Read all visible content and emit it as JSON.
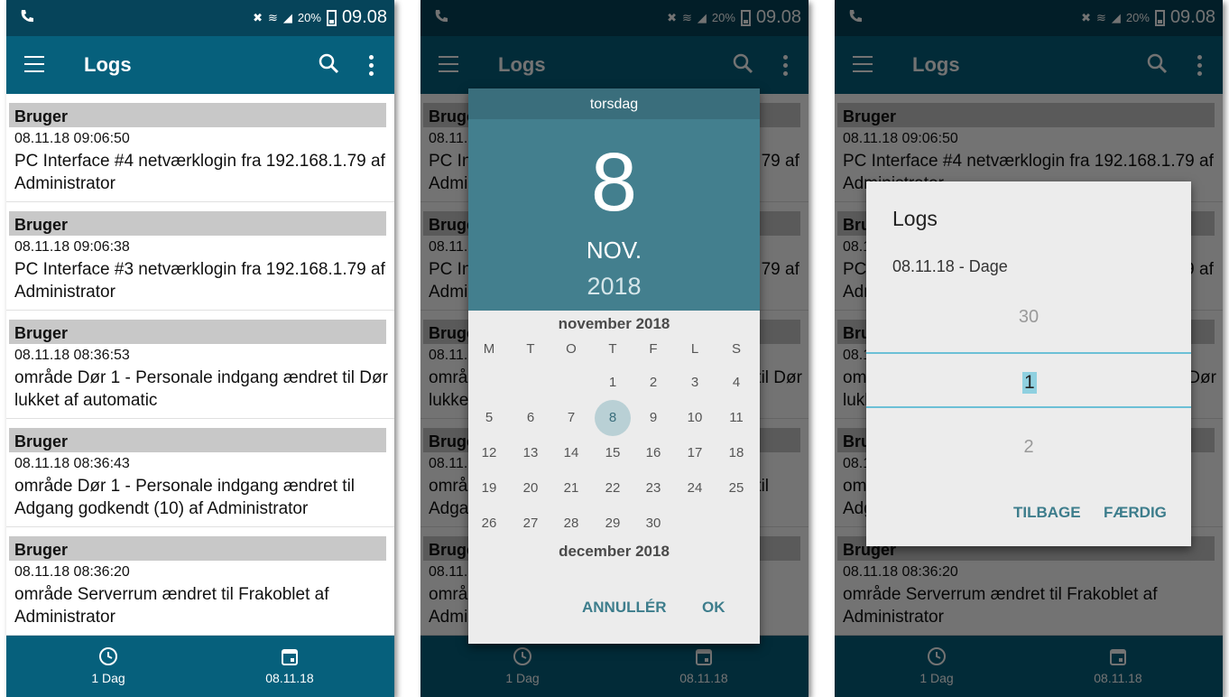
{
  "status": {
    "battery": "20%",
    "time": "09.08"
  },
  "appbar": {
    "title": "Logs"
  },
  "logs": [
    {
      "category": "Bruger",
      "timestamp": "08.11.18 09:06:50",
      "message": "PC Interface #4 netværklogin fra 192.168.1.79 af Administrator"
    },
    {
      "category": "Bruger",
      "timestamp": "08.11.18 09:06:38",
      "message": "PC Interface #3 netværklogin fra 192.168.1.79 af Administrator"
    },
    {
      "category": "Bruger",
      "timestamp": "08.11.18 08:36:53",
      "message": "område Dør 1 - Personale indgang ændret til Dør lukket af automatic"
    },
    {
      "category": "Bruger",
      "timestamp": "08.11.18 08:36:43",
      "message": "område Dør 1 - Personale indgang ændret til Adgang godkendt (10) af Administrator"
    },
    {
      "category": "Bruger",
      "timestamp": "08.11.18 08:36:20",
      "message": "område Serverrum ændret til Frakoblet af Administrator"
    }
  ],
  "bottombar": {
    "range_label": "1 Dag",
    "date_label": "08.11.18"
  },
  "datepicker": {
    "weekday": "torsdag",
    "day": "8",
    "month": "NOV.",
    "year": "2018",
    "month_title": "november 2018",
    "next_month_title": "december 2018",
    "weekday_headers": [
      "M",
      "T",
      "O",
      "T",
      "F",
      "L",
      "S"
    ],
    "days": [
      "1",
      "2",
      "3",
      "4",
      "5",
      "6",
      "7",
      "8",
      "9",
      "10",
      "11",
      "12",
      "13",
      "14",
      "15",
      "16",
      "17",
      "18",
      "19",
      "20",
      "21",
      "22",
      "23",
      "24",
      "25",
      "26",
      "27",
      "28",
      "29",
      "30"
    ],
    "selected_day": "8",
    "cancel_label": "ANNULLÉR",
    "ok_label": "OK"
  },
  "numberpicker": {
    "title": "Logs",
    "subtitle": "08.11.18 - Dage",
    "prev_value": "30",
    "current_value": "1",
    "next_value": "2",
    "back_label": "TILBAGE",
    "done_label": "FÆRDIG"
  }
}
